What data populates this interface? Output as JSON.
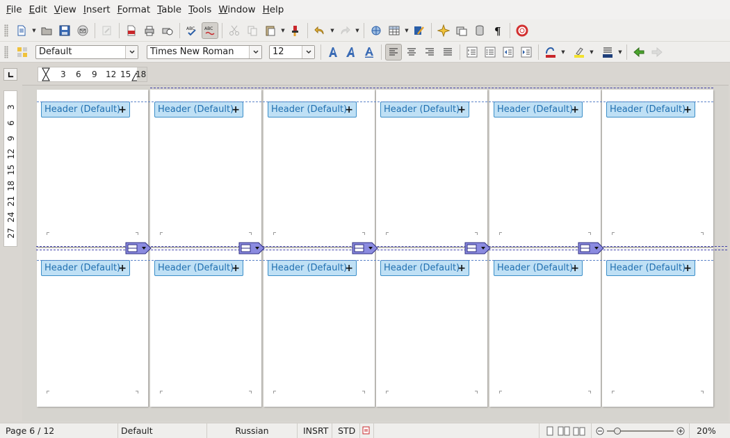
{
  "menubar": {
    "items": [
      {
        "label": "File",
        "u": "F",
        "rest": "ile"
      },
      {
        "label": "Edit",
        "u": "E",
        "rest": "dit"
      },
      {
        "label": "View",
        "u": "V",
        "rest": "iew"
      },
      {
        "label": "Insert",
        "u": "I",
        "rest": "nsert"
      },
      {
        "label": "Format",
        "u": "F",
        "rest": "ormat",
        "pre": ""
      },
      {
        "label": "Table",
        "u": "T",
        "rest": "able"
      },
      {
        "label": "Tools",
        "u": "T",
        "rest": "ools"
      },
      {
        "label": "Window",
        "u": "W",
        "rest": "indow"
      },
      {
        "label": "Help",
        "u": "H",
        "rest": "elp"
      }
    ]
  },
  "format_bar": {
    "paragraph_style": "Default",
    "font_name": "Times New Roman",
    "font_size": "12"
  },
  "ruler": {
    "h_ticks": [
      "3",
      "6",
      "9",
      "12",
      "15",
      "18"
    ],
    "v_ticks": [
      "3",
      "6",
      "9",
      "12",
      "15",
      "18",
      "21",
      "24",
      "27"
    ]
  },
  "document": {
    "header_label": "Header (Default)",
    "plus_glyph": "+",
    "colors": {
      "header_bg": "#bfe0f5",
      "header_border": "#3b8ec8",
      "header_text": "#1f6fb0",
      "page_break": "#3f3fa8"
    }
  },
  "statusbar": {
    "page": "Page 6 / 12",
    "page_style": "Default",
    "language": "Russian",
    "insert_mode": "INSRT",
    "selection_mode": "STD",
    "zoom": "20%"
  }
}
